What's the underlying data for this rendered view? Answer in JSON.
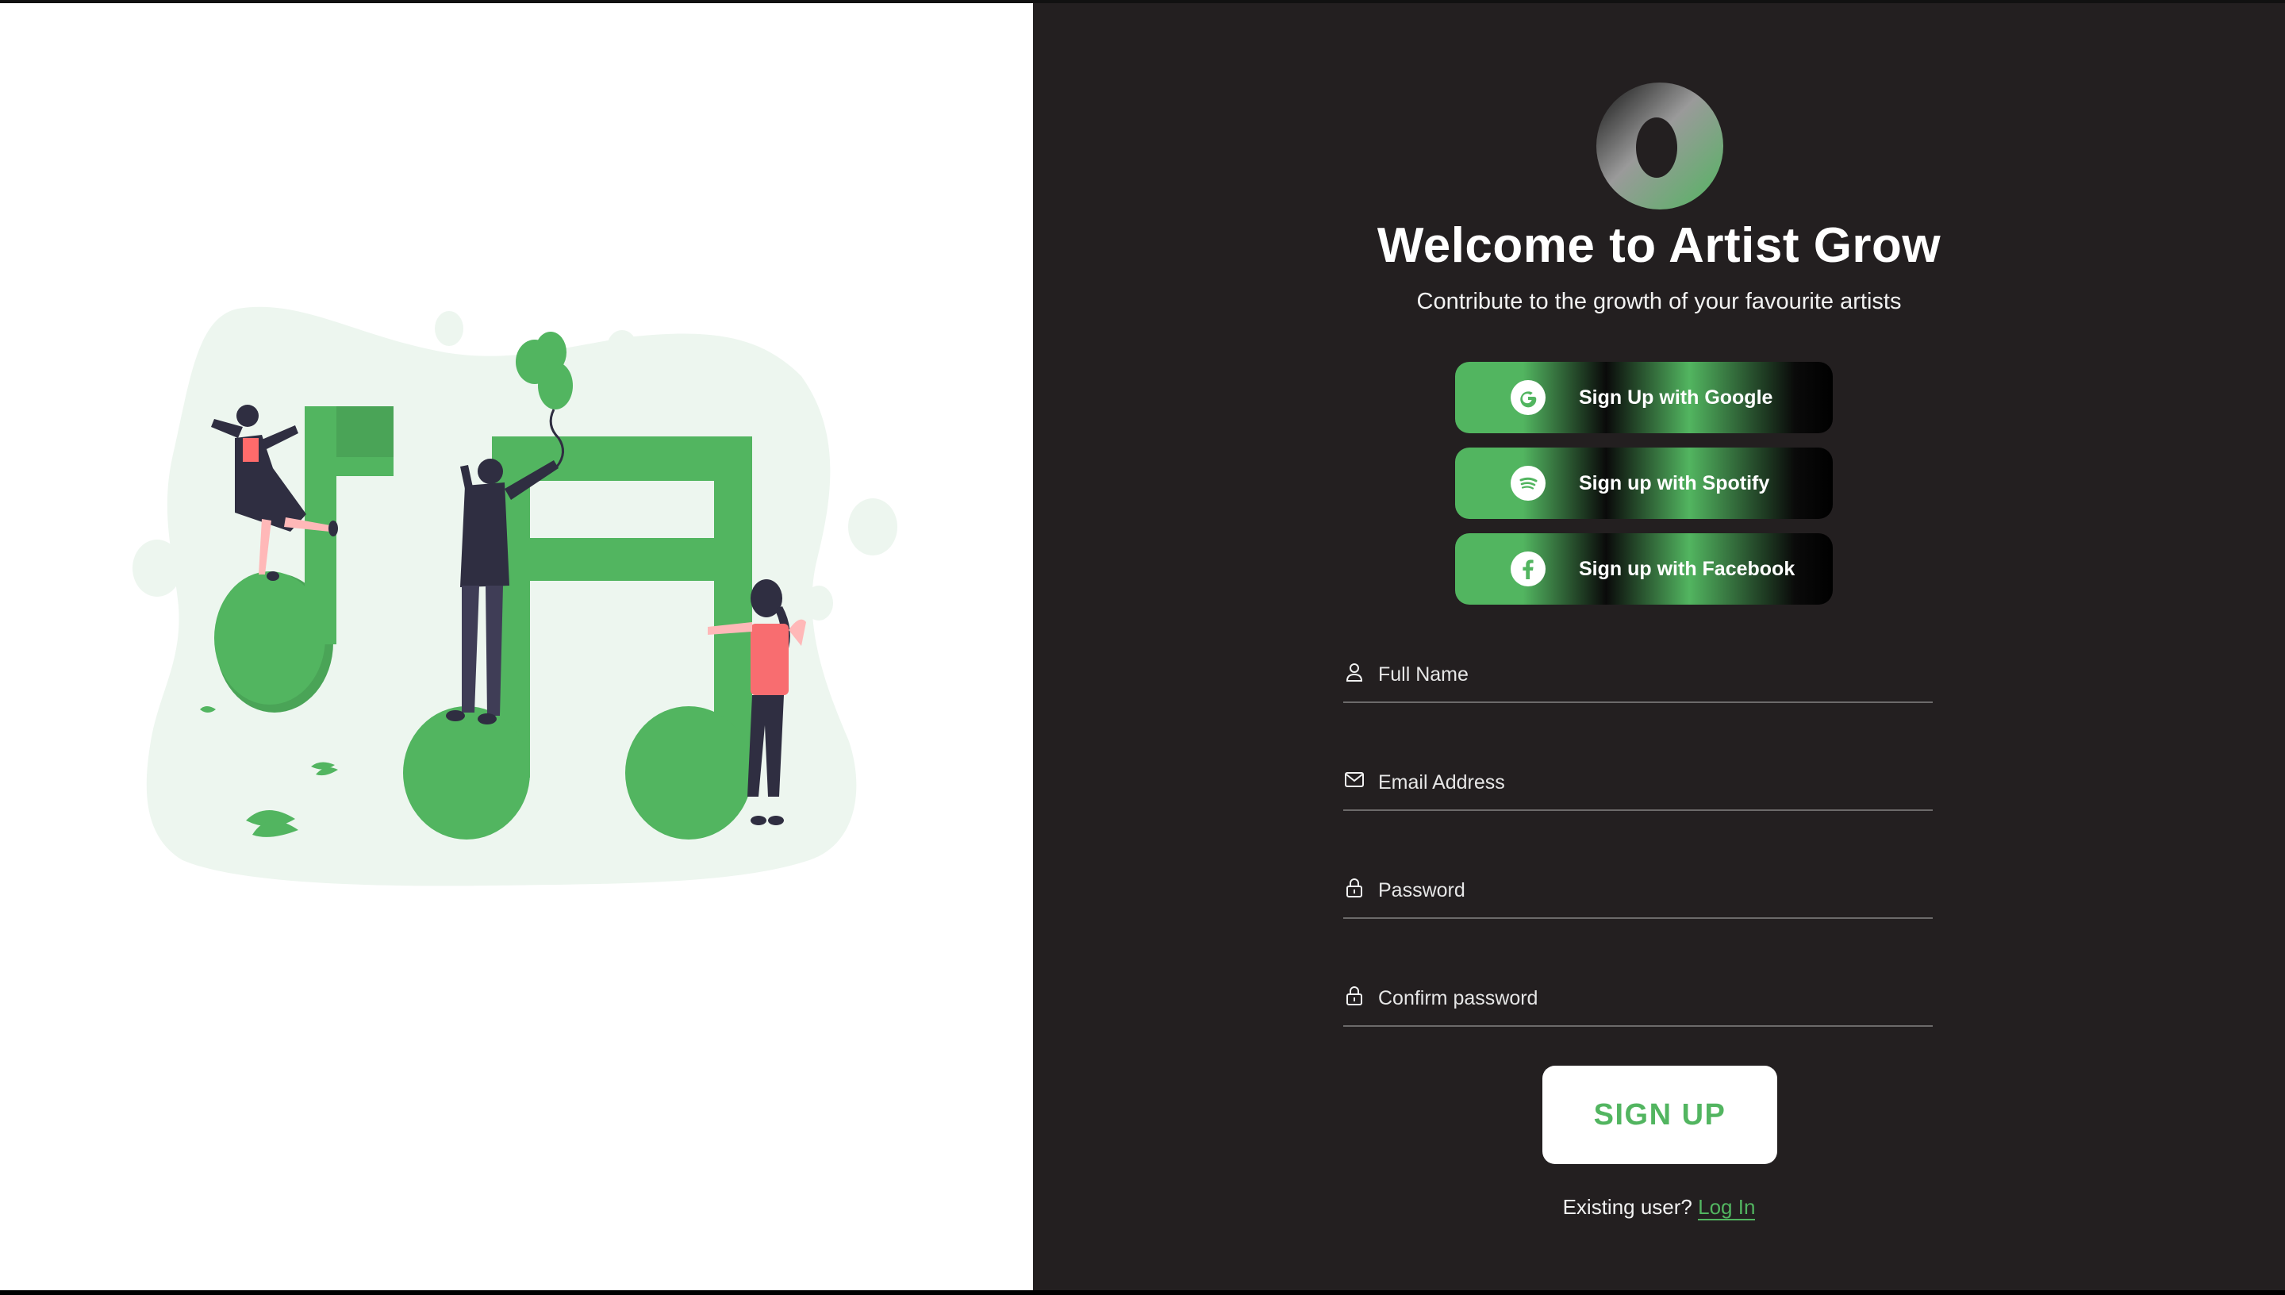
{
  "colors": {
    "accent_green": "#52b560",
    "panel_dark": "#231f20",
    "panel_light": "#ffffff",
    "blob_light_green": "#edf6ef"
  },
  "illustration": {
    "subject": "music-notes-people-illustration"
  },
  "header": {
    "logo_icon": "artist-grow-logo-icon",
    "title": "Welcome to Artist Grow",
    "subtitle": "Contribute to the growth of your favourite artists"
  },
  "social_buttons": [
    {
      "label": "Sign Up with Google",
      "icon": "google-icon"
    },
    {
      "label": "Sign up with Spotify",
      "icon": "spotify-icon"
    },
    {
      "label": "Sign up with Facebook",
      "icon": "facebook-icon"
    }
  ],
  "form": {
    "fields": [
      {
        "placeholder": "Full Name",
        "value": "",
        "icon": "user-icon"
      },
      {
        "placeholder": "Email Address",
        "value": "",
        "icon": "mail-icon"
      },
      {
        "placeholder": "Password",
        "value": "",
        "icon": "lock-icon"
      },
      {
        "placeholder": "Confirm password",
        "value": "",
        "icon": "lock-icon"
      }
    ],
    "submit_label": "SIGN UP"
  },
  "footer": {
    "existing_user_text": "Existing user?",
    "login_link_text": "Log In"
  }
}
